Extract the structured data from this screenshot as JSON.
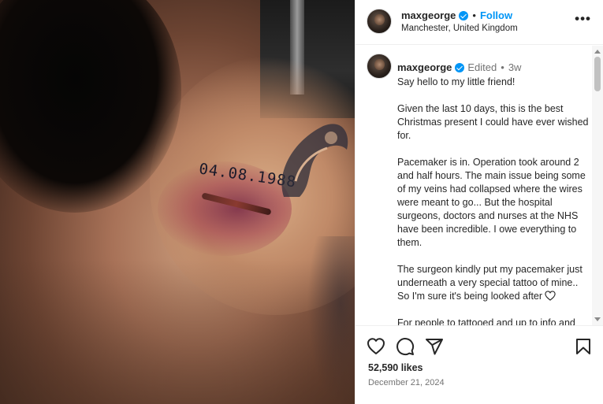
{
  "post": {
    "username": "maxgeorge",
    "location": "Manchester, United Kingdom",
    "follow_label": "Follow",
    "separator": "•",
    "more_label": "•••"
  },
  "media": {
    "tattoo_text": "04.08.1988"
  },
  "caption": {
    "username": "maxgeorge",
    "edited_label": "Edited",
    "separator": "•",
    "time_ago": "3w",
    "paragraphs": [
      "Say hello to my little friend!",
      "Given the last 10 days, this is the best Christmas present I could have ever wished for.",
      "Pacemaker is in. Operation took around 2 and half hours. The main issue being some of my veins had collapsed where the wires were meant to go... But the hospital surgeons, doctors and nurses at the NHS have been incredible. I owe everything to them.",
      "The surgeon kindly put my pacemaker just underneath a very special tattoo of mine.. So I'm sure it's being looked after",
      "For people to tattooed and up to info and"
    ]
  },
  "actions": {
    "likes": "52,590 likes",
    "date": "December 21, 2024"
  },
  "icons": {
    "like": "heart-icon",
    "comment": "comment-bubble-icon",
    "share": "paper-plane-icon",
    "save": "bookmark-icon",
    "verified": "verified-badge-icon",
    "more": "more-options-icon"
  },
  "colors": {
    "accent": "#0095f6",
    "text": "#262626",
    "muted": "#737373",
    "border": "#efefef"
  }
}
